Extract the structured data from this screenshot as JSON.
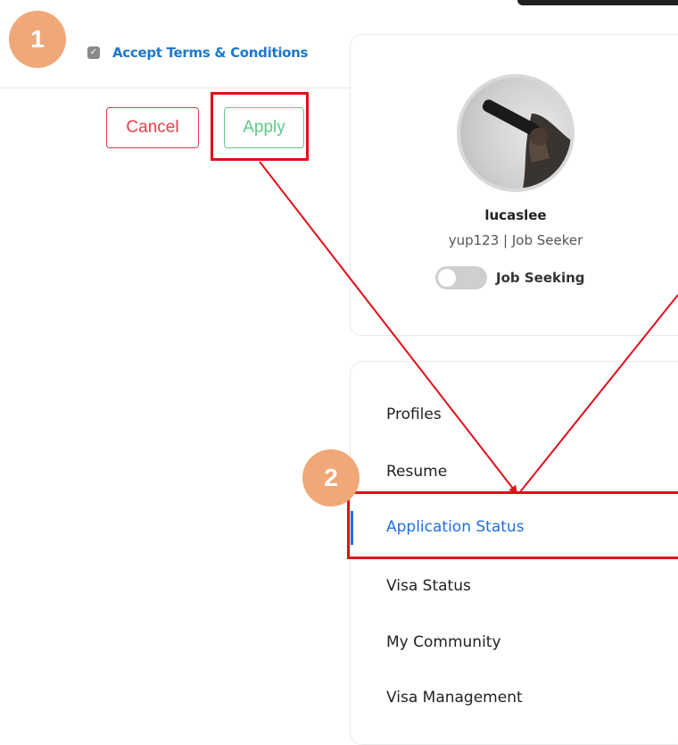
{
  "annotations": {
    "step1": "1",
    "step2": "2"
  },
  "terms": {
    "checked": true,
    "label": "Accept Terms & Conditions"
  },
  "actions": {
    "cancel_label": "Cancel",
    "apply_label": "Apply"
  },
  "profile": {
    "username": "lucaslee",
    "meta": "yup123 | Job Seeker",
    "toggle_label": "Job Seeking",
    "toggle_on": false
  },
  "menu": {
    "items": [
      {
        "label": "Profiles"
      },
      {
        "label": "Resume"
      },
      {
        "label": "Application Status",
        "active": true
      },
      {
        "label": "Visa Status"
      },
      {
        "label": "My Community"
      },
      {
        "label": "Visa Management"
      }
    ]
  },
  "colors": {
    "accent": "#1f6fe0",
    "highlight": "#e0101a",
    "badge": "#f0a878",
    "cancel": "#e04048",
    "apply": "#5fc98a"
  }
}
